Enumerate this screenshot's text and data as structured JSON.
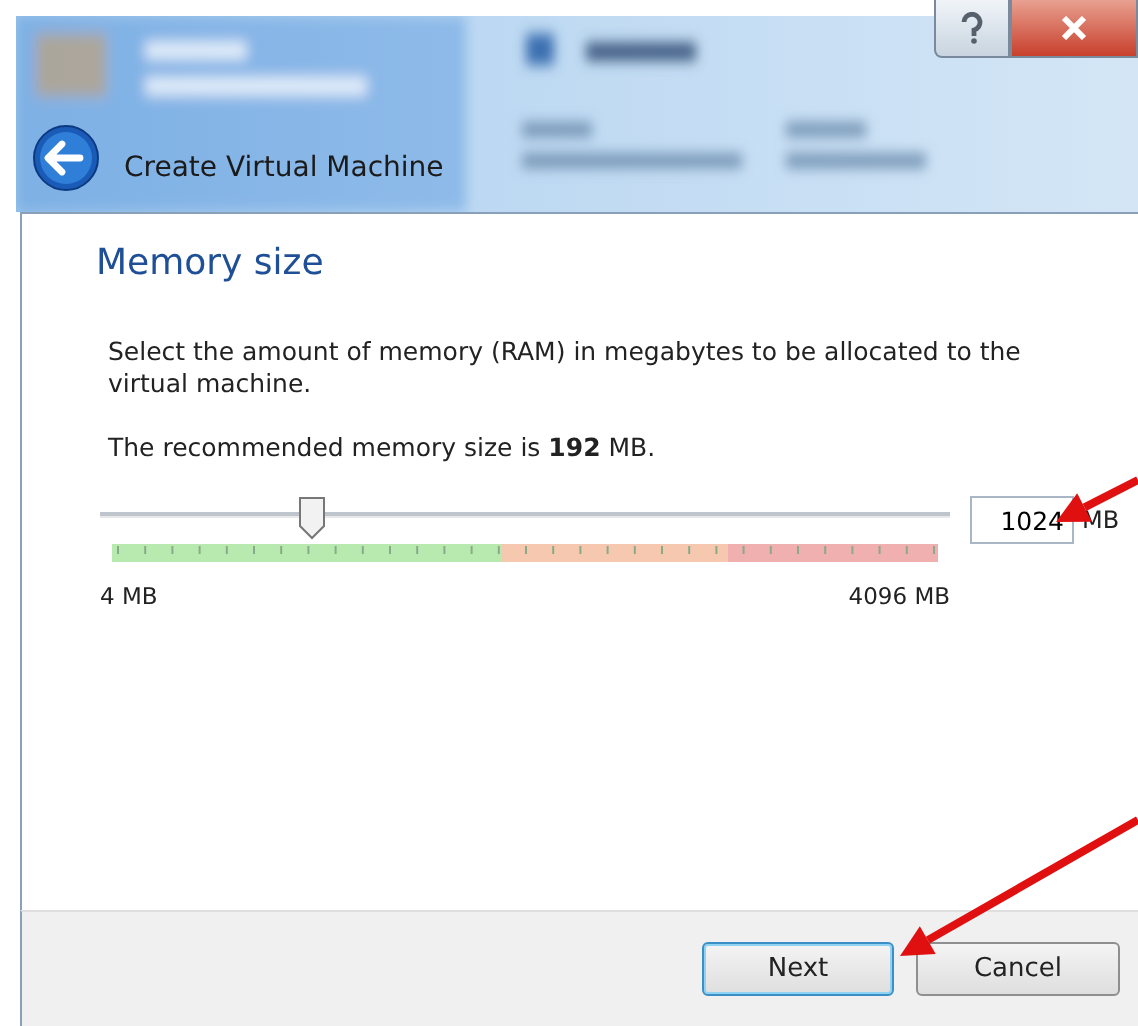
{
  "window": {
    "title": "Create Virtual Machine"
  },
  "page": {
    "heading": "Memory size",
    "description": "Select the amount of memory (RAM) in megabytes to be allocated to the virtual machine.",
    "recommendation": "The recommended memory size is **192** MB."
  },
  "memory": {
    "level": 0.25,
    "value": "1024",
    "unit": "MB",
    "min_label": "4 MB",
    "max_label": "4096 MB"
  },
  "buttons": [
    {
      "label": "Next",
      "selected": true
    },
    {
      "label": "Cancel",
      "selected": false
    }
  ]
}
